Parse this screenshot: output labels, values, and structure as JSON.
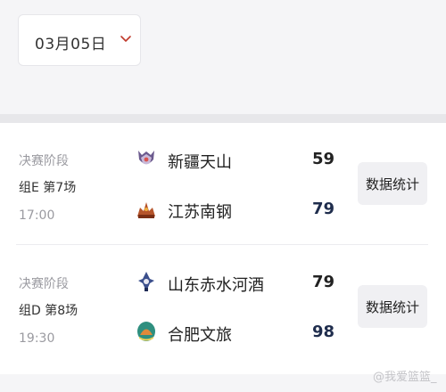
{
  "date_picker": {
    "label": "03月05日",
    "chevron_icon": "chevron-down-icon",
    "chevron_color": "#c0392b"
  },
  "matches": [
    {
      "stage": "决赛阶段",
      "group": "组E 第7场",
      "time": "17:00",
      "team_a": {
        "name": "新疆天山",
        "score": "59",
        "logo_icon": "xinjiang-team-logo"
      },
      "team_b": {
        "name": "江苏南钢",
        "score": "79",
        "logo_icon": "jiangsu-team-logo"
      },
      "stats_label": "数据统计"
    },
    {
      "stage": "决赛阶段",
      "group": "组D 第8场",
      "time": "19:30",
      "team_a": {
        "name": "山东赤水河酒",
        "score": "79",
        "logo_icon": "shandong-team-logo"
      },
      "team_b": {
        "name": "合肥文旅",
        "score": "98",
        "logo_icon": "hefei-team-logo"
      },
      "stats_label": "数据统计"
    }
  ],
  "watermark": "@我爱篮篮_"
}
